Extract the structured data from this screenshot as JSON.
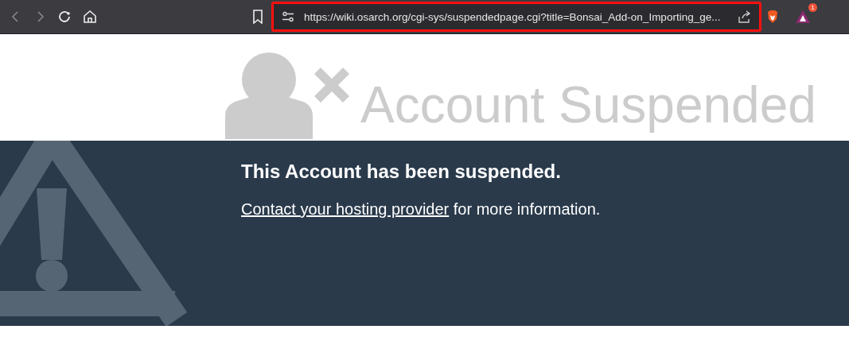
{
  "browser": {
    "address": "https://wiki.osarch.org/cgi-sys/suspendedpage.cgi?title=Bonsai_Add-on_Importing_ge...",
    "address_highlighted": true,
    "extension_badge": "1"
  },
  "header": {
    "title": "Account Suspended"
  },
  "banner": {
    "heading": "This Account has been suspended.",
    "link": "Contact your hosting provider",
    "text": " for more information."
  }
}
